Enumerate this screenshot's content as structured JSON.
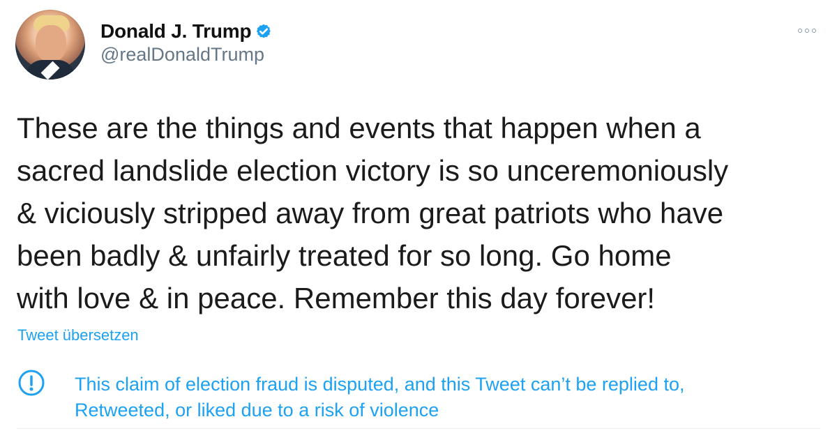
{
  "tweet": {
    "author": {
      "display_name": "Donald J. Trump",
      "handle": "@realDonaldTrump",
      "avatar_icon": "profile-photo",
      "verified_icon": "verified-badge-icon"
    },
    "more_icon": "more-options-icon",
    "body": "These are the things and events that happen when a\nsacred landslide election victory is so unceremoniously\n& viciously stripped away from great patriots who have\nbeen badly & unfairly treated for so long. Go home\nwith love & in peace. Remember this day forever!",
    "translate_label": "Tweet übersetzen",
    "notice": {
      "icon": "warning-circle-icon",
      "text": "This claim of election fraud is disputed, and this Tweet can’t be replied to,\nRetweeted, or liked due to a risk of violence"
    }
  },
  "colors": {
    "text_primary": "#111111",
    "text_secondary": "#657786",
    "link_blue": "#1da1f2",
    "verified_blue": "#1da1f2",
    "divider": "#e6ecf0",
    "background": "#ffffff"
  }
}
